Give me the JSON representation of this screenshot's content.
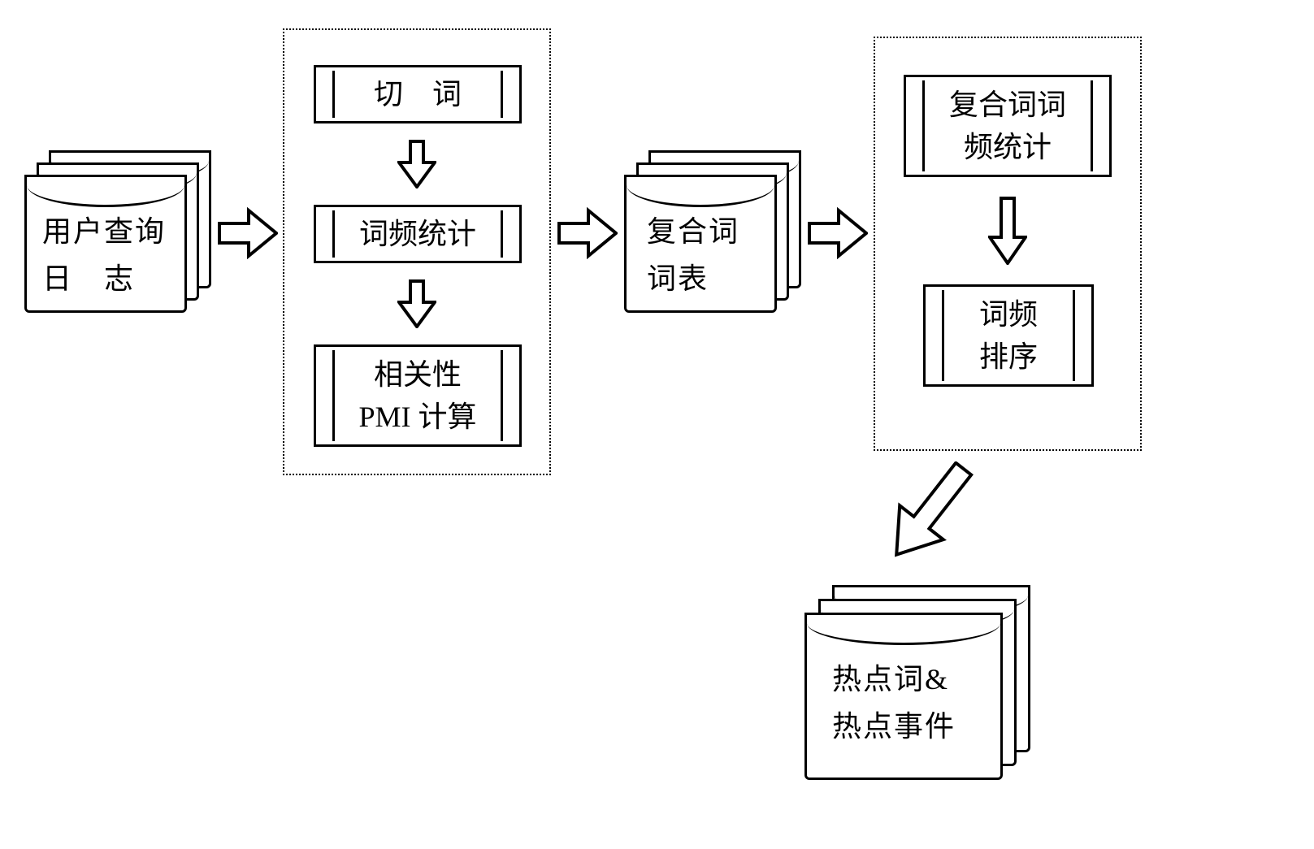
{
  "stacks": {
    "input": {
      "line1": "用户查询",
      "line2": "日　志"
    },
    "compound": {
      "line1": "复合词",
      "line2": "词表"
    },
    "output": {
      "line1": "热点词&",
      "line2": "热点事件"
    }
  },
  "box1": {
    "step1": "切　词",
    "step2": "词频统计",
    "step3_line1": "相关性",
    "step3_line2": "PMI 计算"
  },
  "box2": {
    "step1_line1": "复合词词",
    "step1_line2": "频统计",
    "step2_line1": "词频",
    "step2_line2": "排序"
  }
}
